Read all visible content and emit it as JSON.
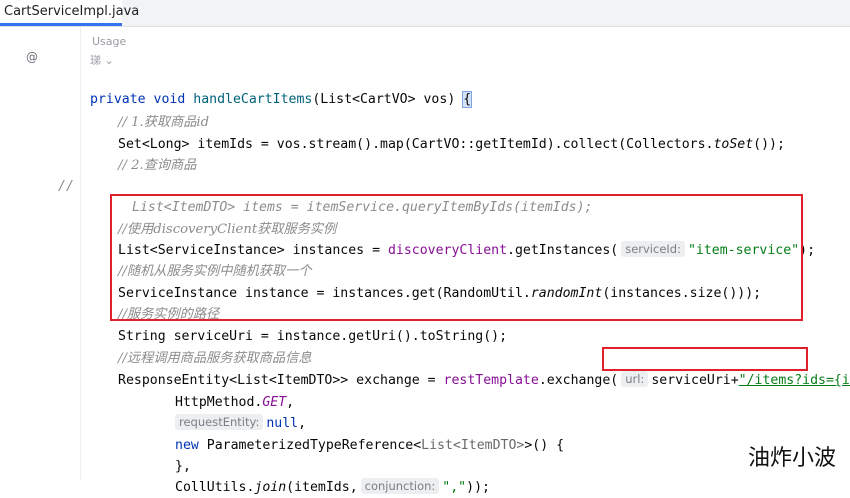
{
  "tab": {
    "title": "CartServiceImpl.java"
  },
  "top_hints": {
    "usage": "Usage",
    "author": "珶 ⌄"
  },
  "gutter": {
    "override_marker": "@",
    "comment_marker": "//"
  },
  "lines": {
    "l1": {
      "kw1": "private",
      "kw2": "void",
      "method": "handleCartItems",
      "rest": "(List<CartVO> vos) ",
      "brace": "{"
    },
    "c1": "// 1.获取商品id",
    "l3": {
      "pre": "Set<Long> itemIds = vos.stream().map(CartVO::getItemId).collect(Collectors.",
      "it": "toSet",
      "post": "());"
    },
    "c2": "// 2.查询商品",
    "l5": "List<ItemDTO> items = itemService.queryItemByIds(itemIds);",
    "c3": "//使用discoveryClient获取服务实例",
    "l7": {
      "pre": "List<ServiceInstance> instances = ",
      "fld": "discoveryClient",
      "mid": ".getInstances(",
      "hint": "serviceId:",
      "str": "\"item-service\"",
      "post": ");"
    },
    "c4": "//随机从服务实例中随机获取一个",
    "l9": {
      "pre": "ServiceInstance instance = instances.get(RandomUtil.",
      "it": "randomInt",
      "post": "(instances.size()));"
    },
    "c5": "//服务实例的路径",
    "l11": "String serviceUri = instance.getUri().toString();",
    "c6": "//远程调用商品服务获取商品信息",
    "l13": {
      "pre": "ResponseEntity<List<ItemDTO>> exchange = ",
      "fld": "restTemplate",
      "mid": ".exchange(",
      "hint": "url:",
      "boxed_var": "serviceUri+",
      "str": "\"/items?ids={ids}\"",
      "post": ","
    },
    "l14": {
      "pre": "HttpMethod.",
      "it": "GET",
      "post": ","
    },
    "l15": {
      "hint": "requestEntity:",
      "kw": "null",
      "post": ","
    },
    "l16": {
      "kw": "new",
      "pre": " ParameterizedTypeReference<",
      "gen": "List<ItemDTO>",
      "post": ">() {"
    },
    "l17": "},",
    "l18": {
      "pre": "CollUtils.",
      "it": "join",
      "mid": "(itemIds,",
      "hint": "conjunction:",
      "str": "\",\"",
      "post": "));"
    }
  },
  "watermark": "油炸小波"
}
